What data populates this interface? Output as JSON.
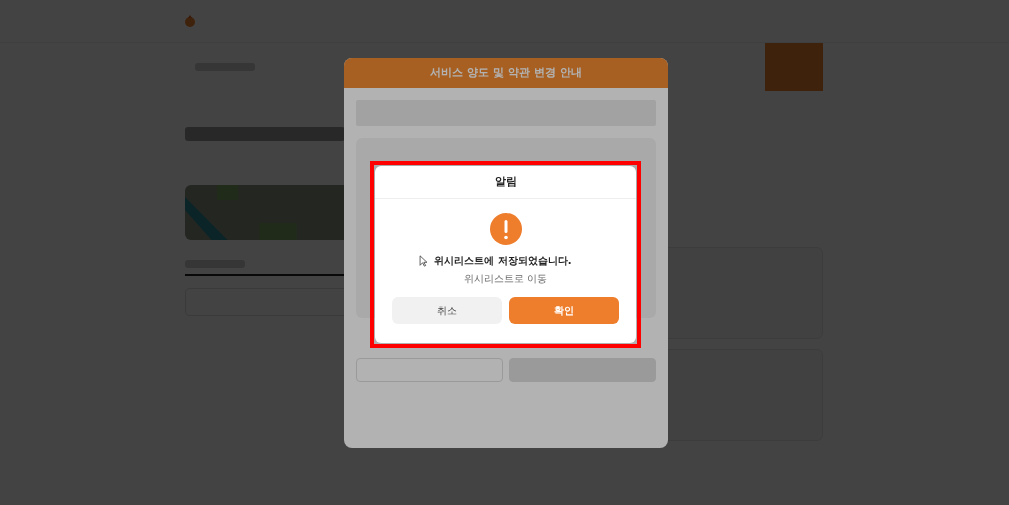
{
  "notice_modal": {
    "title": "서비스 양도 및 약관 변경 안내"
  },
  "alert": {
    "title": "알림",
    "message": "위시리스트에 저장되었습니다.",
    "link": "위시리스트로 이동",
    "buttons": [
      {
        "label": "취소",
        "kind": "secondary"
      },
      {
        "label": "확인",
        "kind": "primary"
      }
    ]
  }
}
